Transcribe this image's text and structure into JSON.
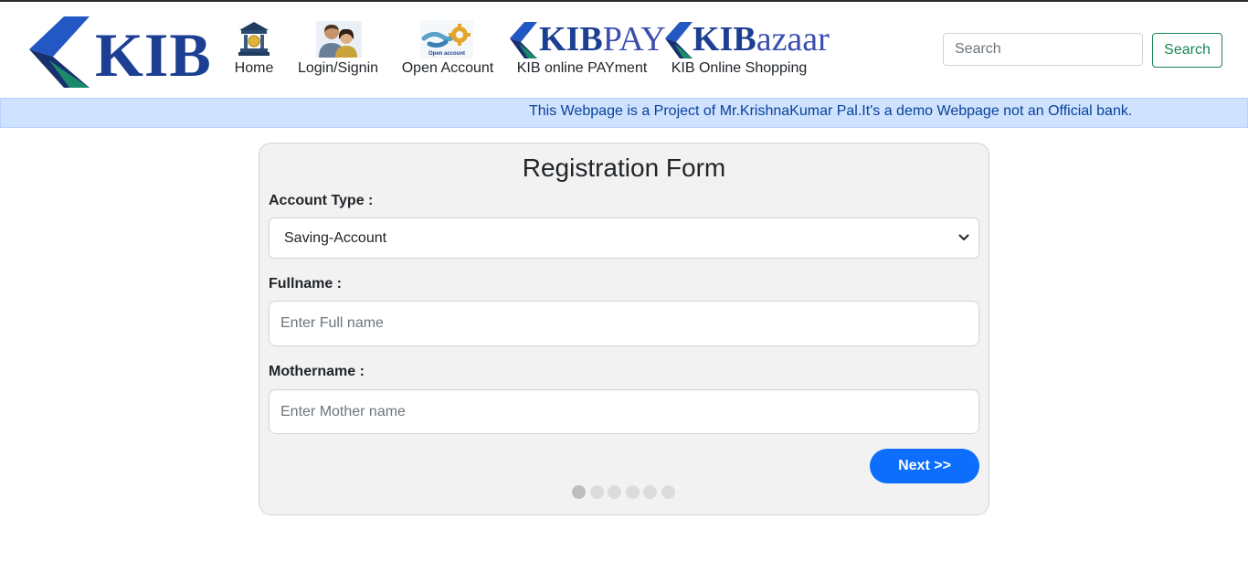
{
  "navbar": {
    "brand_text": "KIB",
    "items": [
      {
        "label": "Home",
        "icon": "bank-icon"
      },
      {
        "label": "Login/Signin",
        "icon": "users-icon"
      },
      {
        "label": "Open Account",
        "icon": "handshake-gear-icon",
        "icon_caption": "Open account"
      },
      {
        "label": "KIB online PAYment",
        "logo_bold": "KIB",
        "logo_light": "PAY"
      },
      {
        "label": "KIB Online Shopping",
        "logo_bold": "KIB",
        "logo_light": "azaar"
      }
    ]
  },
  "search": {
    "placeholder": "Search",
    "value": "",
    "button_label": "Search"
  },
  "alert": {
    "text": "This Webpage is a Project of Mr.KrishnaKumar Pal.It's a demo Webpage not an Official bank."
  },
  "form": {
    "title": "Registration Form",
    "account_type_label": "Account Type :",
    "account_type_value": "Saving-Account",
    "fullname_label": "Fullname :",
    "fullname_placeholder": "Enter Full name",
    "fullname_value": "",
    "mothername_label": "Mothername :",
    "mothername_placeholder": "Enter Mother name",
    "mothername_value": "",
    "next_label": "Next >>",
    "steps_total": 6,
    "current_step": 1
  },
  "colors": {
    "brand_blue": "#1c3f93",
    "brand_green": "#1a8a6b",
    "alert_bg": "#cfe2ff",
    "alert_text": "#084298",
    "search_green": "#198754",
    "primary": "#0d6efd",
    "card_bg": "#f2f2f2"
  }
}
